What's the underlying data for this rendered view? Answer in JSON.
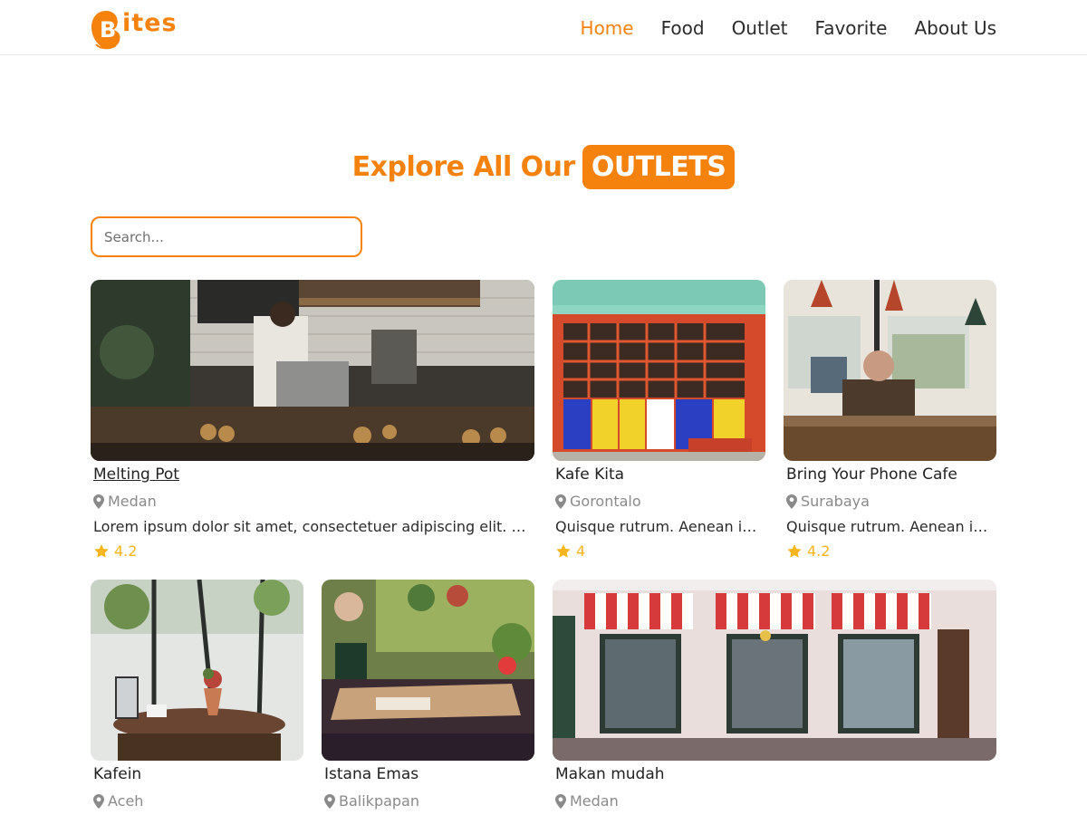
{
  "brand": {
    "name": "ites",
    "initial": "B",
    "color": "#f5820d"
  },
  "nav": [
    {
      "label": "Home",
      "active": true
    },
    {
      "label": "Food",
      "active": false
    },
    {
      "label": "Outlet",
      "active": false
    },
    {
      "label": "Favorite",
      "active": false
    },
    {
      "label": "About Us",
      "active": false
    }
  ],
  "hero": {
    "title": "Explore All Our",
    "highlight": "OUTLETS"
  },
  "search": {
    "placeholder": "Search..."
  },
  "outlets": [
    {
      "name": "Melting Pot",
      "location": "Medan",
      "description": "Lorem ipsum dolor sit amet, consectetuer adipiscing elit. A...",
      "rating": "4.2",
      "image": "coffee bar barista"
    },
    {
      "name": "Kafe Kita",
      "location": "Gorontalo",
      "description": "Quisque rutrum. Aenean im...",
      "rating": "4",
      "image": "colorful kiosk storefront"
    },
    {
      "name": "Bring Your Phone Cafe",
      "location": "Surabaya",
      "description": "Quisque rutrum. Aenean im...",
      "rating": "4.2",
      "image": "man sitting in cafe"
    },
    {
      "name": "Kafein",
      "location": "Aceh",
      "description": "",
      "rating": "",
      "image": "french press on table"
    },
    {
      "name": "Istana Emas",
      "location": "Balikpapan",
      "description": "",
      "rating": "",
      "image": "vintage cafe interior"
    },
    {
      "name": "Makan mudah",
      "location": "Medan",
      "description": "",
      "rating": "",
      "image": "storefront with striped awnings"
    }
  ],
  "colors": {
    "accent": "#f5820d",
    "star": "#f7b51e",
    "muted": "#8a8a8a"
  }
}
